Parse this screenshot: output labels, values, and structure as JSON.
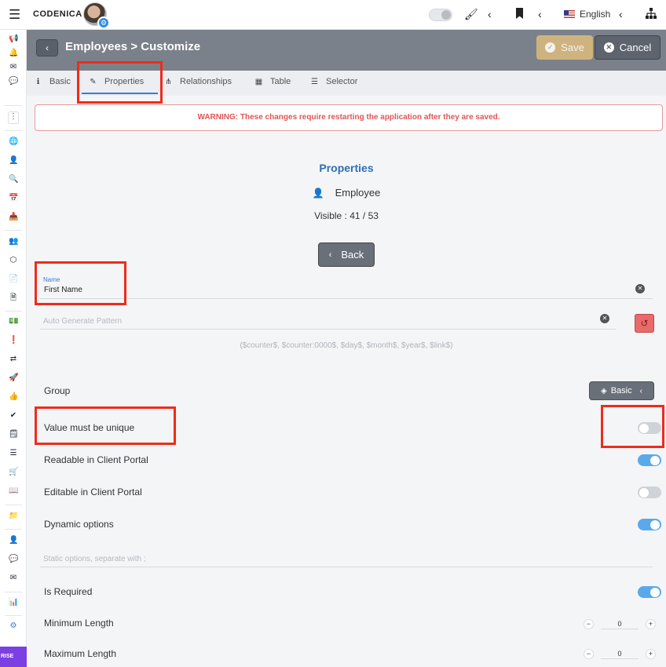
{
  "topbar": {
    "brand": "CODENICA",
    "language": "English"
  },
  "sidebar": {
    "badge": "RISE"
  },
  "header": {
    "title": "Employees > Customize",
    "save_label": "Save",
    "cancel_label": "Cancel"
  },
  "tabs": [
    {
      "label": "Basic",
      "icon": "info-icon"
    },
    {
      "label": "Properties",
      "icon": "edit-icon"
    },
    {
      "label": "Relationships",
      "icon": "sitemap-icon"
    },
    {
      "label": "Table",
      "icon": "table-icon"
    },
    {
      "label": "Selector",
      "icon": "list-icon"
    }
  ],
  "warning": "WARNING: These changes require restarting the application after they are saved.",
  "properties": {
    "title": "Properties",
    "entity": "Employee",
    "visible": "Visible : 41 / 53",
    "back_label": "Back"
  },
  "form": {
    "name_label": "Name",
    "name_value": "First Name",
    "pattern_placeholder": "Auto Generate Pattern",
    "pattern_hint": "($counter$, $counter:0000$, $day$, $month$, $year$, $link$)",
    "group_label": "Group",
    "group_value": "Basic",
    "unique_label": "Value must be unique",
    "readable_label": "Readable in Client Portal",
    "editable_label": "Editable in Client Portal",
    "dynamic_label": "Dynamic options",
    "static_placeholder": "Static options, separate with ;",
    "required_label": "Is Required",
    "min_label": "Minimum Length",
    "min_value": "0",
    "max_label": "Maximum Length",
    "max_value": "0"
  },
  "toggles": {
    "unique": false,
    "readable": true,
    "editable": false,
    "dynamic": true,
    "required": true
  },
  "colors": {
    "accent": "#3a7bd5",
    "highlight": "#ef2b1b",
    "header": "#7b818a",
    "save": "#d9b97d",
    "toggle_on": "#5aa9ea"
  }
}
